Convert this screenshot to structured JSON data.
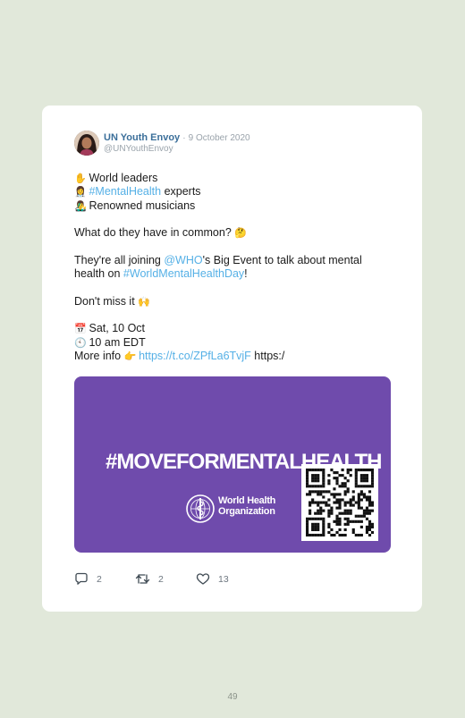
{
  "post": {
    "author_name": "UN Youth Envoy",
    "separator": "·",
    "date": "9 October 2020",
    "handle": "@UNYouthEnvoy",
    "lines": {
      "l1": "World leaders",
      "l2_tag": "#MentalHealth",
      "l2_rest": " experts",
      "l3": "Renowned musicians",
      "l4": "What do they have in common?",
      "l5_a": "They're all joining ",
      "l5_mention": "@WHO",
      "l5_b": "'s Big Event to talk about mental",
      "l6_a": "health on ",
      "l6_tag": "#WorldMentalHealthDay",
      "l6_b": "!",
      "l7": "Don't miss it",
      "l8": "Sat, 10 Oct",
      "l9": "10 am EDT",
      "l10_a": "More info ",
      "l10_link": "https://t.co/ZPfLa6TvjF",
      "l10_b": " https:/"
    },
    "emojis": {
      "wave": "✋",
      "health_worker": "👩‍⚕️",
      "singer": "👨‍🎤",
      "thinking": "🤔",
      "raised_hands": "🙌",
      "calendar": "📅",
      "clock": "🕙",
      "pointing": "👉"
    },
    "media": {
      "banner_text": "#MOVEFORMENTALHEALTH",
      "org_line1": "World Health",
      "org_line2": "Organization",
      "background_color": "#6f4bac"
    },
    "actions": {
      "replies": "2",
      "retweets": "2",
      "likes": "13"
    }
  },
  "page_number": "49",
  "colors": {
    "page_background": "#e1e8da",
    "link": "#55b0e6",
    "author": "#3b6f9a"
  }
}
